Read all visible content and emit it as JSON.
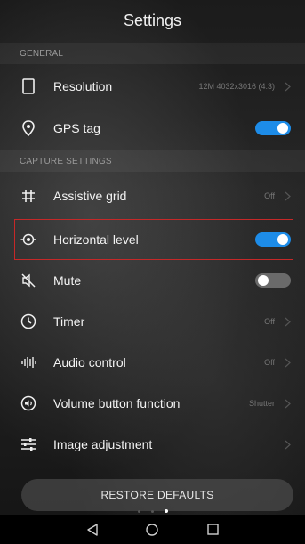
{
  "title": "Settings",
  "sections": {
    "general": "GENERAL",
    "capture": "CAPTURE SETTINGS"
  },
  "rows": {
    "resolution": {
      "label": "Resolution",
      "value": "12M 4032x3016 (4:3)",
      "icon": "resolution-frame-icon"
    },
    "gps": {
      "label": "GPS tag",
      "icon": "location-pin-icon",
      "toggle": true
    },
    "grid": {
      "label": "Assistive grid",
      "value": "Off",
      "icon": "grid-hash-icon"
    },
    "level": {
      "label": "Horizontal level",
      "icon": "level-target-icon",
      "toggle": true
    },
    "mute": {
      "label": "Mute",
      "icon": "mute-icon",
      "toggle": false
    },
    "timer": {
      "label": "Timer",
      "value": "Off",
      "icon": "timer-clock-icon"
    },
    "audio": {
      "label": "Audio control",
      "value": "Off",
      "icon": "audio-bars-icon"
    },
    "volume": {
      "label": "Volume button function",
      "value": "Shutter",
      "icon": "volume-icon"
    },
    "image": {
      "label": "Image adjustment",
      "icon": "sliders-icon"
    }
  },
  "restore_label": "RESTORE DEFAULTS",
  "pager": {
    "pages": 3,
    "active": 3
  },
  "colors": {
    "accent": "#1d8ce8",
    "highlight": "#c62828"
  }
}
